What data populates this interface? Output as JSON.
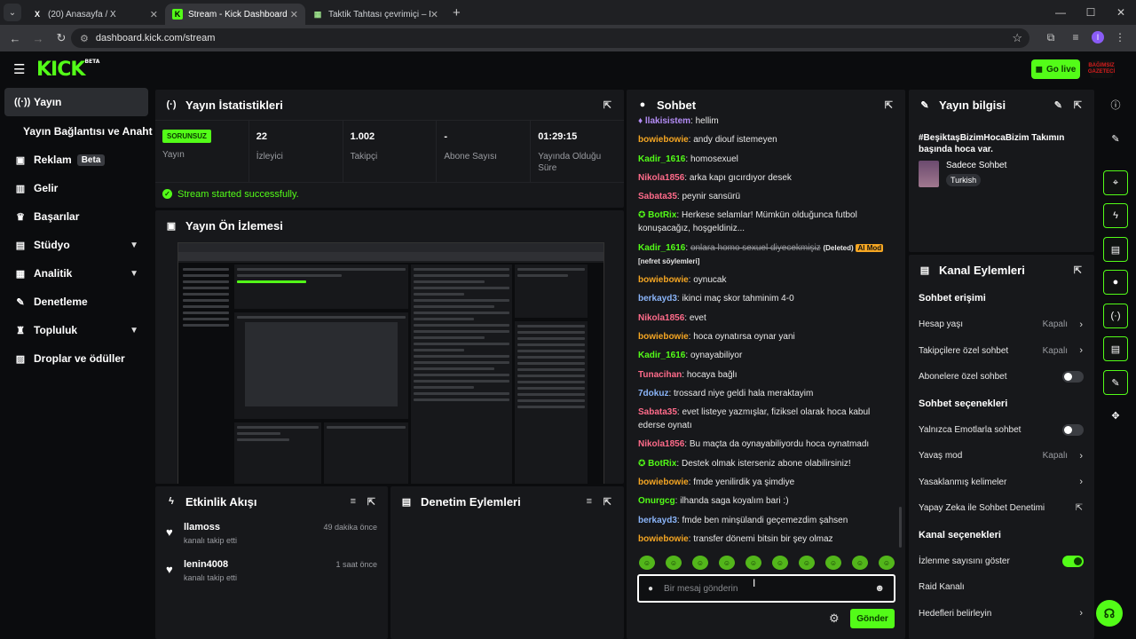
{
  "browser": {
    "tabs": [
      {
        "icon": "X",
        "title": "(20) Anasayfa / X"
      },
      {
        "icon": "K",
        "title": "Stream - Kick Dashboard"
      },
      {
        "icon": "▦",
        "title": "Taktik Tahtası çevrimiçi – Futbol"
      }
    ],
    "url": "dashboard.kick.com/stream",
    "profile_initial": "I"
  },
  "header": {
    "logo": "KICK",
    "logo_badge": "BETA",
    "go_live": "Go live",
    "avatar_text": "BAĞIMSIZ GAZETECİ"
  },
  "sidebar": {
    "items": [
      {
        "label": "Yayın",
        "icon": "broadcast-icon"
      },
      {
        "label": "Yayın Bağlantısı ve Anahtarı",
        "icon": ""
      },
      {
        "label": "Reklam",
        "icon": "ad-icon",
        "badge": "Beta"
      },
      {
        "label": "Gelir",
        "icon": "chart-icon"
      },
      {
        "label": "Başarılar",
        "icon": "trophy-icon"
      },
      {
        "label": "Stüdyo",
        "icon": "studio-icon"
      },
      {
        "label": "Analitik",
        "icon": "analytics-icon"
      },
      {
        "label": "Denetleme",
        "icon": "wrench-icon"
      },
      {
        "label": "Topluluk",
        "icon": "community-icon"
      },
      {
        "label": "Droplar ve ödüller",
        "icon": "gift-icon"
      }
    ]
  },
  "stats_panel": {
    "title": "Yayın İstatistikleri",
    "status_badge": "SORUNSUZ",
    "status_label": "Yayın",
    "stats": [
      {
        "value": "22",
        "label": "İzleyici"
      },
      {
        "value": "1.002",
        "label": "Takipçi"
      },
      {
        "value": "-",
        "label": "Abone Sayısı"
      },
      {
        "value": "01:29:15",
        "label": "Yayında Olduğu Süre"
      }
    ],
    "success_msg": "Stream started successfully."
  },
  "preview_panel": {
    "title": "Yayın Ön İzlemesi"
  },
  "activity_panel": {
    "title": "Etkinlik Akışı",
    "items": [
      {
        "name": "llamoss",
        "sub": "kanalı takip etti",
        "time": "49 dakika önce"
      },
      {
        "name": "lenin4008",
        "sub": "kanalı takip etti",
        "time": "1 saat önce"
      }
    ]
  },
  "moderation_panel": {
    "title": "Denetim Eylemleri"
  },
  "chat": {
    "title": "Sohbet",
    "messages": [
      {
        "user": "llakisistem",
        "color": "#b38cf5",
        "text": "hellim"
      },
      {
        "user": "bowiebowie",
        "color": "#f5a623",
        "text": "andy diouf istemeyen"
      },
      {
        "user": "Kadir_1616",
        "color": "#53fc18",
        "text": "homosexuel"
      },
      {
        "user": "Nikola1856",
        "color": "#ff6b8a",
        "text": "arka kapı gıcırdıyor desek"
      },
      {
        "user": "Sabata35",
        "color": "#ff6b8a",
        "text": "peynir sansürü"
      },
      {
        "user": "BotRix",
        "color": "#53fc18",
        "text": "Herkese selamlar! Mümkün olduğunca futbol konuşacağız, hoşgeldiniz..."
      },
      {
        "user": "Kadir_1616",
        "color": "#53fc18",
        "deleted_text": "onlara homo sexuel diyecekmişiz",
        "deleted_label": "(Deleted)",
        "mod_tag": "AI Mod",
        "reason": "[nefret söylemleri]"
      },
      {
        "user": "bowiebowie",
        "color": "#f5a623",
        "text": "oynucak"
      },
      {
        "user": "berkayd3",
        "color": "#8ab4f8",
        "text": "ikinci maç skor tahminim 4-0"
      },
      {
        "user": "Nikola1856",
        "color": "#ff6b8a",
        "text": "evet"
      },
      {
        "user": "bowiebowie",
        "color": "#f5a623",
        "text": "hoca oynatırsa oynar yani"
      },
      {
        "user": "Kadir_1616",
        "color": "#53fc18",
        "text": "oynayabiliyor"
      },
      {
        "user": "Tunacihan",
        "color": "#ff6b8a",
        "text": "hocaya bağlı"
      },
      {
        "user": "7dokuz",
        "color": "#8ab4f8",
        "text": "trossard niye geldi hala meraktayim"
      },
      {
        "user": "Sabata35",
        "color": "#ff6b8a",
        "text": "evet listeye yazmışlar, fiziksel olarak hoca kabul ederse oynatı"
      },
      {
        "user": "Nikola1856",
        "color": "#ff6b8a",
        "text": "Bu maçta da oynayabiliyordu hoca oynatmadı"
      },
      {
        "user": "BotRix",
        "color": "#53fc18",
        "text": "Destek olmak isterseniz abone olabilirsiniz!"
      },
      {
        "user": "bowiebowie",
        "color": "#f5a623",
        "text": "fmde yenilirdik ya şimdiye"
      },
      {
        "user": "Onurgcg",
        "color": "#53fc18",
        "text": "ilhanda saga koyalım bari :)"
      },
      {
        "user": "berkayd3",
        "color": "#8ab4f8",
        "text": "fmde ben minşülandi geçemezdim şahsen"
      },
      {
        "user": "bowiebowie",
        "color": "#f5a623",
        "text": "transfer dönemi bitsin bir şey olmaz"
      }
    ],
    "placeholder": "Bir mesaj gönderin",
    "send_label": "Gönder"
  },
  "stream_info": {
    "title": "Yayın bilgisi",
    "stream_title": "#BeşiktaşBizimHocaBizim Takımın başında hoca var.",
    "category": "Sadece Sohbet",
    "tag": "Turkish"
  },
  "channel_actions": {
    "title": "Kanal Eylemleri",
    "chat_access": "Sohbet erişimi",
    "account_age": "Hesap yaşı",
    "account_age_val": "Kapalı",
    "followers_only": "Takipçilere özel sohbet",
    "followers_only_val": "Kapalı",
    "subs_only": "Abonelere özel sohbet",
    "chat_options": "Sohbet seçenekleri",
    "emote_only": "Yalnızca Emotlarla sohbet",
    "slow_mode": "Yavaş mod",
    "slow_mode_val": "Kapalı",
    "banned_words": "Yasaklanmış kelimeler",
    "ai_moderation": "Yapay Zeka ile Sohbet Denetimi",
    "channel_options": "Kanal seçenekleri",
    "show_viewers": "İzlenme sayısını göster",
    "raid": "Raid Kanalı",
    "goals": "Hedefleri belirleyin"
  }
}
